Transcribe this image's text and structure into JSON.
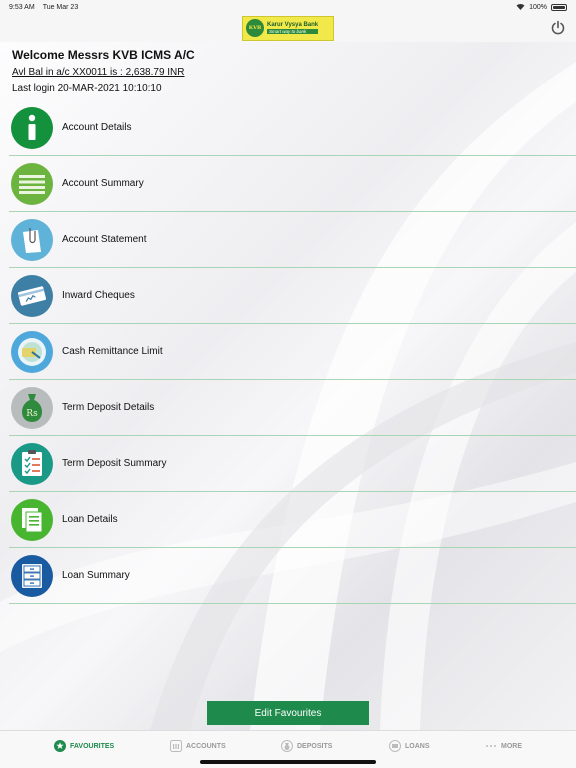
{
  "status_bar": {
    "time": "9:53 AM",
    "date": "Tue Mar 23",
    "battery": "100%"
  },
  "header": {
    "bank_name": "Karur Vysya Bank",
    "bank_tagline": "Smart way to bank",
    "seal_text": "KVB"
  },
  "account": {
    "welcome": "Welcome Messrs KVB ICMS A/C",
    "balance": "Avl Bal in a/c XX0011 is : 2,638.79 INR",
    "last_login": "Last login 20-MAR-2021 10:10:10"
  },
  "menu": {
    "items": [
      {
        "label": "Account Details",
        "icon": "info-icon",
        "color": "#14913d"
      },
      {
        "label": "Account Summary",
        "icon": "list-icon",
        "color": "#6cb33f"
      },
      {
        "label": "Account Statement",
        "icon": "document-clip-icon",
        "color": "#5fb3d9"
      },
      {
        "label": "Inward Cheques",
        "icon": "cheque-icon",
        "color": "#3e7fa6"
      },
      {
        "label": "Cash Remittance Limit",
        "icon": "cash-limit-icon",
        "color": "#4fa8dc"
      },
      {
        "label": "Term Deposit Details",
        "icon": "money-bag-icon",
        "color": "#b9bcbd",
        "symbol": "Rs"
      },
      {
        "label": "Term Deposit Summary",
        "icon": "checklist-icon",
        "color": "#1a9a86"
      },
      {
        "label": "Loan Details",
        "icon": "pages-icon",
        "color": "#47b52f"
      },
      {
        "label": "Loan Summary",
        "icon": "cabinet-icon",
        "color": "#1a5aa0"
      }
    ]
  },
  "edit_button": "Edit Favourites",
  "tabs": [
    {
      "label": "FAVOURITES",
      "icon": "star-icon",
      "active": true
    },
    {
      "label": "ACCOUNTS",
      "icon": "bank-icon",
      "active": false
    },
    {
      "label": "DEPOSITS",
      "icon": "deposit-icon",
      "active": false
    },
    {
      "label": "LOANS",
      "icon": "loan-icon",
      "active": false
    },
    {
      "label": "MORE",
      "icon": "more-icon",
      "active": false
    }
  ],
  "colors": {
    "accent": "#1e8a4b",
    "divider": "#a8d6b5",
    "inactive_tab": "#999999"
  }
}
